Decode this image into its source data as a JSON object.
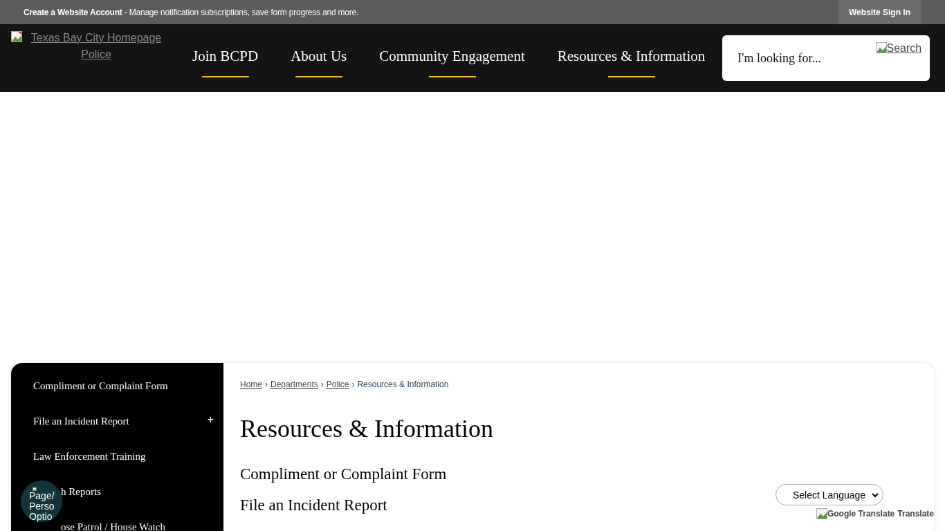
{
  "top_bar": {
    "account_link": {
      "bold": "Create a Website Account",
      "rest": " - Manage notification subscriptions, save form progress and more."
    },
    "sign_in": "Website Sign In"
  },
  "header": {
    "logo_alt": "Texas Bay City Homepage Police",
    "nav": [
      {
        "label": "Join BCPD"
      },
      {
        "label": "About Us"
      },
      {
        "label": "Community Engagement"
      },
      {
        "label": "Resources & Information"
      }
    ],
    "search": {
      "placeholder": "I'm looking for...",
      "button_alt": "Search"
    }
  },
  "sidebar": {
    "items": [
      {
        "label": "Compliment or Complaint Form",
        "kind": "link"
      },
      {
        "label": "File an Incident Report",
        "toggle": "+",
        "kind": "link"
      },
      {
        "label": "Law Enforcement Training",
        "kind": "link"
      },
      {
        "label": "h Reports",
        "kind": "link_under_overlay"
      },
      {
        "label": "ose Patrol / House Watch",
        "kind": "link_under_overlay"
      }
    ]
  },
  "breadcrumb": {
    "separator": "›",
    "items": [
      {
        "label": "Home",
        "link": true
      },
      {
        "label": "Departments",
        "link": true
      },
      {
        "label": "Police",
        "link": true
      },
      {
        "label": "Resources & Information",
        "link": false
      }
    ]
  },
  "page_title": "Resources & Information",
  "content_links": [
    "Compliment or Complaint Form",
    "File an Incident Report"
  ],
  "floating_button": {
    "alt_lines": [
      "Page/",
      "Perso",
      "Optio"
    ]
  },
  "translate": {
    "select": "Select Language",
    "alt": "Google Translate",
    "label": "Translate"
  }
}
